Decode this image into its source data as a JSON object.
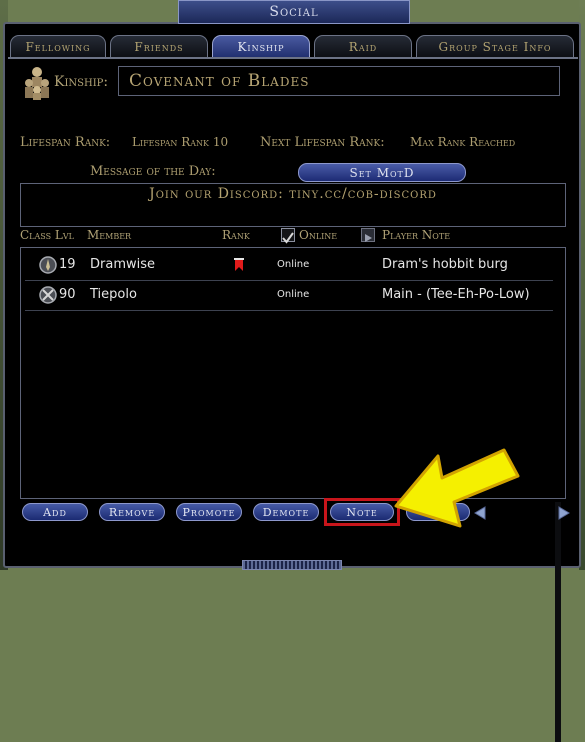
{
  "window": {
    "title": "Social"
  },
  "tabs": [
    {
      "label": "Fellowing"
    },
    {
      "label": "Friends"
    },
    {
      "label": "Kinship",
      "active": true
    },
    {
      "label": "Raid"
    },
    {
      "label": "Group Stage Info"
    }
  ],
  "kinship": {
    "label": "Kinship:",
    "name": "Covenant of Blades",
    "lifespan_rank_label": "Lifespan Rank:",
    "lifespan_rank_value": "Lifespan Rank 10",
    "next_rank_label": "Next Lifespan Rank:",
    "next_rank_value": "Max Rank Reached",
    "motd_label": "Message of the Day:",
    "set_motd_button": "Set MotD",
    "motd_text": "Join our Discord: tiny.cc/cob-discord"
  },
  "columns": {
    "class_lvl": "Class Lvl",
    "member": "Member",
    "rank": "Rank",
    "online": "Online",
    "player_note": "Player Note",
    "online_checked": true
  },
  "members": [
    {
      "class_icon": "hobbit-class-icon",
      "level": "19",
      "name": "Dramwise",
      "rank_icon": "red-banner-icon",
      "status": "Online",
      "note": "Dram's hobbit burg"
    },
    {
      "class_icon": "crossed-swords-class-icon",
      "level": "90",
      "name": "Tiepolo",
      "rank_icon": "",
      "status": "Online",
      "note": "Main - (Tee-Eh-Po-Low)"
    }
  ],
  "buttons": {
    "add": "Add",
    "remove": "Remove",
    "promote": "Promote",
    "demote": "Demote",
    "note": "Note",
    "quit": "Quit"
  },
  "colors": {
    "highlight": "#c8151b",
    "pointer_arrow": "#f5f000",
    "gold_text": "#b0a276",
    "button_blue": "#1b2a72"
  }
}
